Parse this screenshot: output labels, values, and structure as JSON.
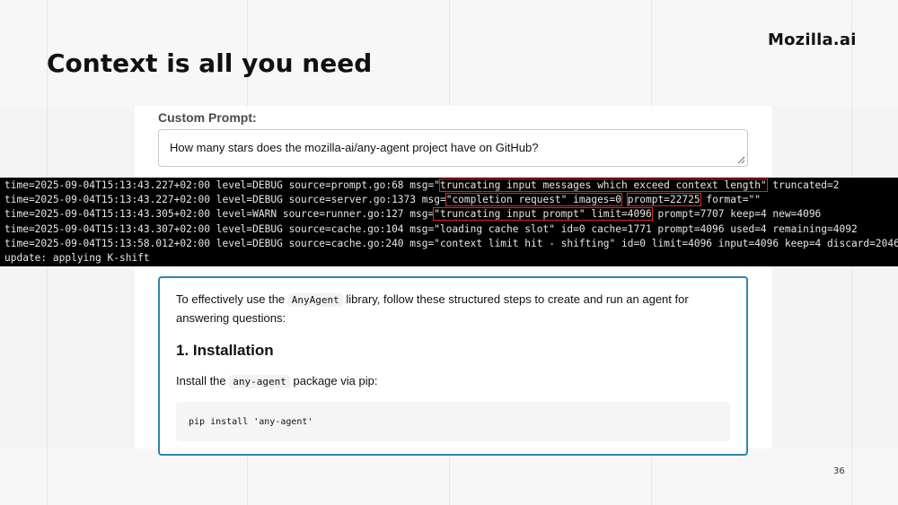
{
  "slide": {
    "title": "Context is all you need",
    "brand": "Mozilla.ai",
    "page_number": "36"
  },
  "prompt": {
    "label": "Custom Prompt:",
    "value": "How many stars does the mozilla-ai/any-agent project have on GitHub?"
  },
  "logs": [
    {
      "pre": "time=2025-09-04T15:13:43.227+02:00 level=DEBUG source=prompt.go:68 msg=\"",
      "h1": "truncating input messages which exceed context length\"",
      "mid": " truncated=2",
      "h2": "",
      "post": ""
    },
    {
      "pre": "time=2025-09-04T15:13:43.227+02:00 level=DEBUG source=server.go:1373 msg=",
      "h1": "\"completion request\" images=0",
      "mid": " ",
      "h2": "prompt=22725",
      "post": " format=\"\""
    },
    {
      "pre": "time=2025-09-04T15:13:43.305+02:00 level=WARN source=runner.go:127 msg=",
      "h1": "\"truncating input prompt\" limit=4096",
      "mid": " prompt=7707 keep=4 new=4096",
      "h2": "",
      "post": ""
    },
    {
      "pre": "time=2025-09-04T15:13:43.307+02:00 level=DEBUG source=cache.go:104 msg=\"loading cache slot\" id=0 cache=1771 prompt=4096 used=4 remaining=4092",
      "h1": "",
      "mid": "",
      "h2": "",
      "post": ""
    },
    {
      "pre": "time=2025-09-04T15:13:58.012+02:00 level=DEBUG source=cache.go:240 msg=\"context limit hit - shifting\" id=0 limit=4096 input=4096 keep=4 discard=2046",
      "h1": "",
      "mid": "",
      "h2": "",
      "post": ""
    },
    {
      "pre": "update: applying K-shift",
      "h1": "",
      "mid": "",
      "h2": "",
      "post": ""
    }
  ],
  "response": {
    "p1_before": "To effectively use the ",
    "p1_code": "AnyAgent",
    "p1_after": " library, follow these structured steps to create and run an agent for answering questions:",
    "heading": "1. Installation",
    "p2_before": "Install the ",
    "p2_code": "any-agent",
    "p2_after": " package via pip:",
    "code": "pip install 'any-agent'"
  },
  "colors": {
    "highlight": "#e02424",
    "card_border": "#2f86a8",
    "terminal_bg": "#000000"
  }
}
